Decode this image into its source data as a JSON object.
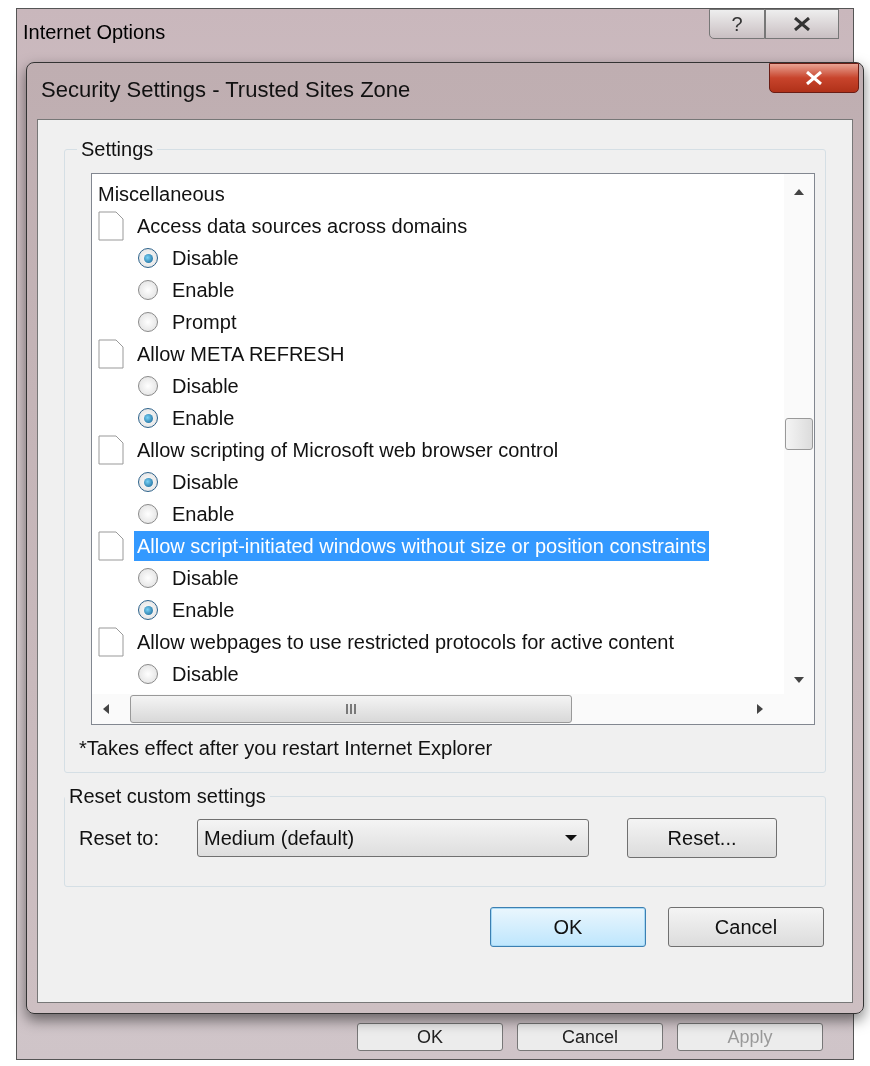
{
  "background_window": {
    "title": "Internet Options",
    "help": "?",
    "buttons": [
      {
        "label": "OK",
        "disabled": false
      },
      {
        "label": "Cancel",
        "disabled": false
      },
      {
        "label": "Apply",
        "disabled": true
      }
    ]
  },
  "dialog": {
    "title": "Security Settings - Trusted Sites Zone",
    "settings": {
      "label": "Settings",
      "category": "Miscellaneous",
      "items": [
        {
          "label": "Access data sources across domains",
          "selected": false,
          "options": [
            {
              "label": "Disable",
              "selected": true
            },
            {
              "label": "Enable",
              "selected": false
            },
            {
              "label": "Prompt",
              "selected": false
            }
          ]
        },
        {
          "label": "Allow META REFRESH",
          "selected": false,
          "options": [
            {
              "label": "Disable",
              "selected": false
            },
            {
              "label": "Enable",
              "selected": true
            }
          ]
        },
        {
          "label": "Allow scripting of Microsoft web browser control",
          "selected": false,
          "options": [
            {
              "label": "Disable",
              "selected": true
            },
            {
              "label": "Enable",
              "selected": false
            }
          ]
        },
        {
          "label": "Allow script-initiated windows without size or position constraints",
          "selected": true,
          "options": [
            {
              "label": "Disable",
              "selected": false
            },
            {
              "label": "Enable",
              "selected": true
            }
          ]
        },
        {
          "label": "Allow webpages to use restricted protocols for active content",
          "selected": false,
          "options": [
            {
              "label": "Disable",
              "selected": false
            }
          ]
        }
      ],
      "note": "*Takes effect after you restart Internet Explorer"
    },
    "reset": {
      "label": "Reset custom settings",
      "reset_to_label": "Reset to:",
      "dropdown": {
        "value": "Medium (default)"
      },
      "reset_button": "Reset..."
    },
    "buttons": [
      {
        "label": "OK",
        "default": true
      },
      {
        "label": "Cancel",
        "default": false
      }
    ]
  }
}
